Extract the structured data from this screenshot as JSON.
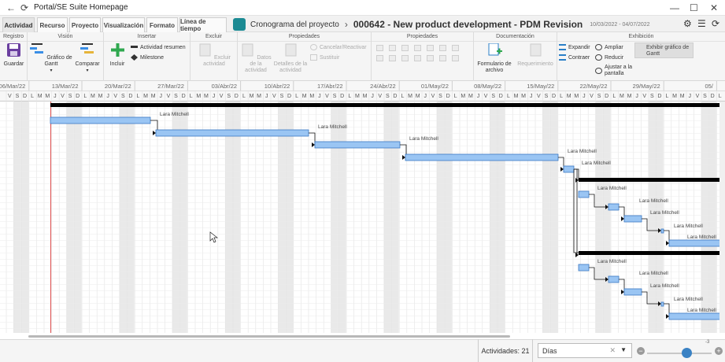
{
  "window": {
    "title": "Portal/SE Suite Homepage"
  },
  "tabs": [
    {
      "label": "Actividad",
      "active": true
    },
    {
      "label": "Recurso"
    },
    {
      "label": "Proyecto"
    },
    {
      "label": "Visualización"
    },
    {
      "label": "Formato"
    },
    {
      "label": "Línea de tiempo"
    }
  ],
  "breadcrumb": {
    "section": "Cronograma del proyecto",
    "project": "000642 - New product development - PDM Revision",
    "dates": "10/03/2022 - 04/07/2022"
  },
  "ribbon": {
    "groups": {
      "registro": "Registro",
      "vision": "Visión",
      "insertar": "Insertar",
      "excluir": "Excluir",
      "propiedades1": "Propiedades",
      "propiedades2": "Propiedades",
      "documentacion": "Documentación",
      "exhibicion": "Exhibición"
    },
    "guardar": "Guardar",
    "grafico_gantt": "Gráfico de Gantt",
    "comparar": "Comparar",
    "incluir": "Incluir",
    "actividad_resumen": "Actividad resumen",
    "milestone": "Milestone",
    "excluir_actividad": "Excluir actividad",
    "datos_actividad": "Datos de la actividad",
    "detalles_actividad": "Detalles de la actividad",
    "cancelar_reactivar": "Cancelar/Reactivar",
    "sustituir": "Sustituir",
    "formulario_archivo": "Formulario de archivo",
    "requerimiento": "Requerimiento",
    "expandir": "Expandir",
    "contraer": "Contraer",
    "ampliar": "Ampliar",
    "reducir": "Reducir",
    "ajustar_pantalla": "Ajustar a la pantalla",
    "exhibir_gantt": "Exhibir gráfico de Gantt"
  },
  "timeline": {
    "weeks": [
      "06/Mar/22",
      "13/Mar/22",
      "20/Mar/22",
      "27/Mar/22",
      "03/Abr/22",
      "10/Abr/22",
      "17/Abr/22",
      "24/Abr/22",
      "01/May/22",
      "08/May/22",
      "15/May/22",
      "22/May/22",
      "29/May/22",
      "05/"
    ],
    "day_letters": [
      "V",
      "S",
      "D",
      "L",
      "M",
      "M",
      "J"
    ]
  },
  "assignee": "Lara Mitchell",
  "status": {
    "activities_label": "Actividades: 21",
    "scale_value": "Días",
    "zoom_value": "-3"
  },
  "colors": {
    "bar": "#9ac5f3",
    "bar_border": "#3a78c2",
    "today_line": "#e05050",
    "summary": "#000000"
  }
}
